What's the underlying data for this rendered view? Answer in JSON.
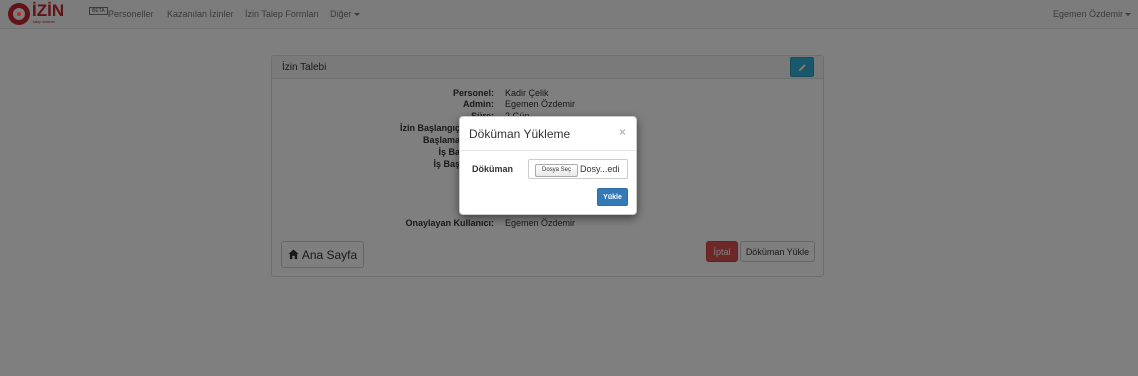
{
  "brand": {
    "name": "İZİN",
    "subtitle": "takip sistemi",
    "badge": "BETA",
    "color": "#c2262e"
  },
  "nav": {
    "items": [
      "Personeller",
      "Kazanılan İzinler",
      "İzin Talep Formları",
      "Diğer"
    ],
    "user": "Egemen Özdemir"
  },
  "panel": {
    "title": "İzin Talebi",
    "details": [
      {
        "label": "Personel:",
        "value": "Kadir Çelik"
      },
      {
        "label": "Admin:",
        "value": "Egemen Özdemir"
      },
      {
        "label": "Süre:",
        "value": "2 Gün"
      },
      {
        "label": "İzin Başlangıç",
        "value": ""
      },
      {
        "label": "Başlama",
        "value": ""
      },
      {
        "label": "İş Ba",
        "value": ""
      },
      {
        "label": "İş Baş",
        "value": ""
      },
      {
        "label": "Onaylayan Kullanıcı:",
        "value": "Egemen Özdemir"
      }
    ],
    "home_button": "Ana Sayfa",
    "cancel_button": "İptal",
    "upload_button": "Döküman Yükle"
  },
  "modal": {
    "title": "Döküman Yükleme",
    "close": "×",
    "field_label": "Döküman",
    "file_button": "Dosya Seç",
    "file_name": "Dosy...edi",
    "submit": "Yükle"
  },
  "colors": {
    "primary": "#337ab7",
    "danger": "#d9534f",
    "info": "#31b0d5"
  }
}
